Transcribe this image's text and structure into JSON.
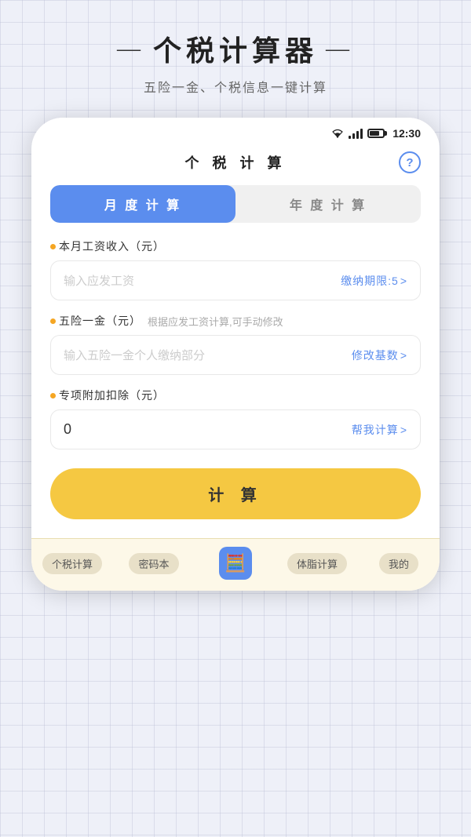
{
  "app": {
    "title": "个税计算器",
    "title_dash_left": "—",
    "title_dash_right": "—",
    "subtitle": "五险一金、个税信息一键计算"
  },
  "status_bar": {
    "time": "12:30"
  },
  "phone": {
    "page_title": "个 税 计 算",
    "help_label": "?",
    "tabs": [
      {
        "id": "monthly",
        "label": "月 度 计 算",
        "active": true
      },
      {
        "id": "annual",
        "label": "年 度 计 算",
        "active": false
      }
    ],
    "fields": [
      {
        "id": "salary",
        "dot": true,
        "label": "本月工资收入（元）",
        "sub_label": "",
        "placeholder": "输入应发工资",
        "value": "",
        "action_text": "缴纳期限:5",
        "action_suffix": ">"
      },
      {
        "id": "insurance",
        "dot": true,
        "label": "五险一金（元）",
        "sub_label": "根据应发工资计算,可手动修改",
        "placeholder": "输入五险一金个人缴纳部分",
        "value": "",
        "action_text": "修改基数",
        "action_suffix": ">"
      },
      {
        "id": "deduction",
        "dot": true,
        "label": "专项附加扣除（元）",
        "sub_label": "",
        "placeholder": "",
        "value": "0",
        "action_text": "帮我计算",
        "action_suffix": ">"
      }
    ],
    "calc_button": "计 算",
    "bottom_nav": [
      {
        "id": "tax",
        "label": "个税计算",
        "type": "pill",
        "active": false
      },
      {
        "id": "password",
        "label": "密码本",
        "type": "pill",
        "active": false
      },
      {
        "id": "calculator",
        "label": "",
        "type": "icon",
        "icon": "🧮",
        "active": true
      },
      {
        "id": "bmi",
        "label": "体脂计算",
        "type": "pill",
        "active": false
      },
      {
        "id": "mine",
        "label": "我的",
        "type": "pill",
        "active": false
      }
    ]
  }
}
